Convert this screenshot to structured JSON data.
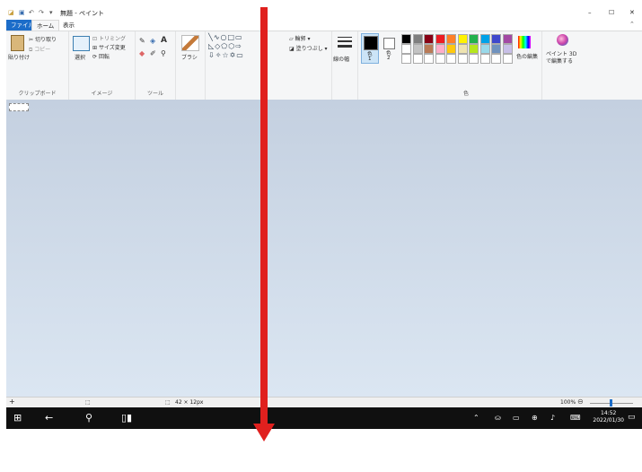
{
  "title_bar": {
    "title": "無題 - ペイント",
    "minimize": "–",
    "maximize": "☐",
    "close": "✕"
  },
  "tabs": {
    "file": "ファイル",
    "home": "ホーム",
    "view": "表示"
  },
  "clipboard": {
    "paste": "貼り付け",
    "cut": "切り取り",
    "copy": "コピー",
    "group": "クリップボード"
  },
  "image": {
    "select": "選択",
    "crop": "トリミング",
    "resize": "サイズ変更",
    "rotate": "回転",
    "group": "イメージ"
  },
  "tools": {
    "group": "ツール"
  },
  "brush": {
    "label": "ブラシ"
  },
  "shapes": {
    "outline": "輪郭",
    "fill": "塗りつぶし"
  },
  "size": {
    "label": "線の幅"
  },
  "colors": {
    "color1": "色",
    "color1_num": "1",
    "color2": "色",
    "color2_num": "2",
    "edit": "色の編集",
    "group": "色",
    "palette": [
      "#000000",
      "#7f7f7f",
      "#880015",
      "#ed1c24",
      "#ff7f27",
      "#fff200",
      "#22b14c",
      "#00a2e8",
      "#3f48cc",
      "#a349a4",
      "#ffffff",
      "#c3c3c3",
      "#b97a57",
      "#ffaec9",
      "#ffc90e",
      "#efe4b0",
      "#b5e61d",
      "#99d9ea",
      "#7092be",
      "#c8bfe7"
    ]
  },
  "paint3d": {
    "label": "ペイント 3D",
    "label2": "で編集する"
  },
  "status": {
    "size": "42 × 12px",
    "zoom": "100%"
  },
  "taskbar": {
    "time": "14:52",
    "date": "2022/01/30"
  },
  "annotation": {
    "color": "#e0201e"
  }
}
